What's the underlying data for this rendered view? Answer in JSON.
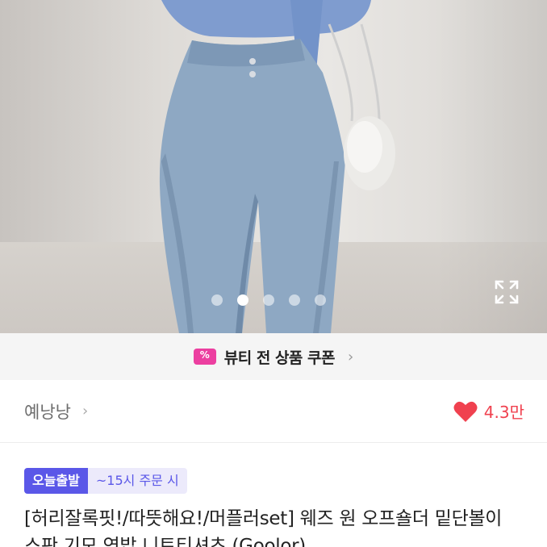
{
  "gallery": {
    "dot_count": 5,
    "active_index": 1
  },
  "coupon": {
    "label": "뷰티 전 상품 쿠폰",
    "icon": "coupon-icon",
    "accent": "#ec3fa0"
  },
  "shop": {
    "name": "예낭낭",
    "likes": "4.3만",
    "heart_color": "#f0414f"
  },
  "product": {
    "badge_same_day": "오늘출발",
    "badge_cutoff": "~15시 주문 시",
    "title": "[허리잘록핏!/따뜻해요!/머플러set] 웨즈 원 오프숄더 밑단볼이 스판 기모 연밥 니트티셔츠 (Goolor)"
  },
  "colors": {
    "badge_purple": "#5a57e8",
    "badge_light": "#eceafb"
  }
}
